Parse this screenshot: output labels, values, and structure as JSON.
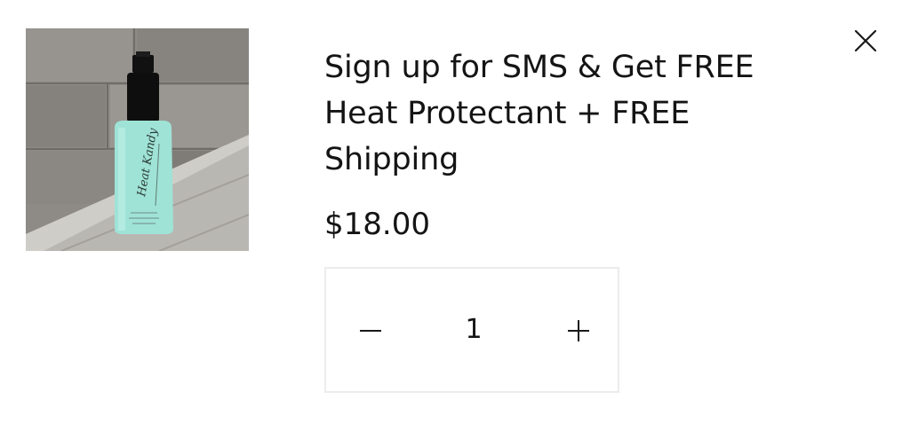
{
  "product": {
    "title": "Sign up for SMS & Get FREE Heat Protectant + FREE Shipping",
    "price": "$18.00",
    "image_label": "Heat Protectant spray bottle"
  },
  "quantity": {
    "value": "1"
  },
  "icons": {
    "close": "close-icon",
    "minus": "minus-icon",
    "plus": "plus-icon"
  },
  "colors": {
    "text": "#141414",
    "bottle": "#9fe3d6",
    "cap": "#111111",
    "border": "#ececec"
  }
}
